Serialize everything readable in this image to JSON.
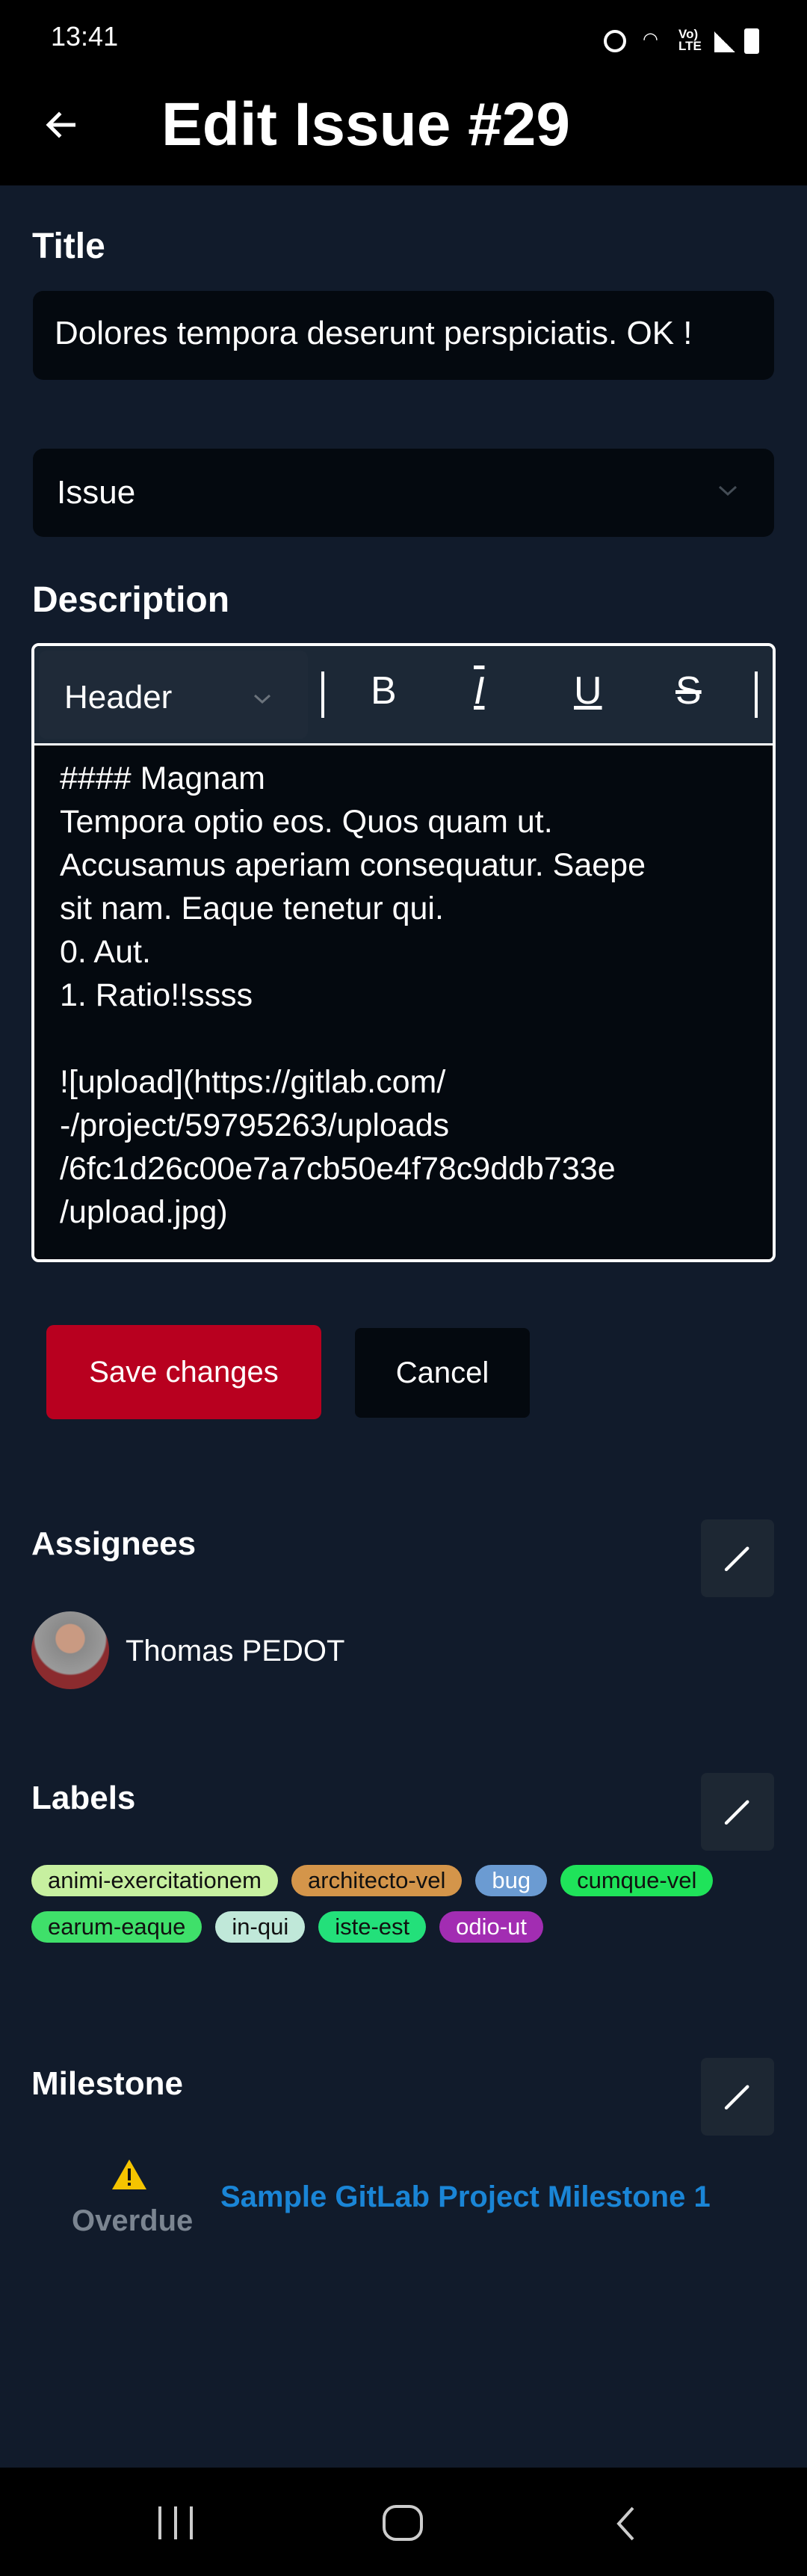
{
  "status_bar": {
    "time": "13:41"
  },
  "header": {
    "title": "Edit Issue #29"
  },
  "form": {
    "title_label": "Title",
    "title_value": "Dolores tempora deserunt perspiciatis. OK !",
    "type_value": "Issue",
    "description_label": "Description",
    "toolbar": {
      "header_select": "Header",
      "bold": "B",
      "italic": "I",
      "underline": "U",
      "strike": "S"
    },
    "description_lines": [
      "#### Magnam",
      "Tempora optio eos. Quos quam ut.",
      "Accusamus aperiam consequatur. Saepe",
      "sit nam. Eaque tenetur qui.",
      "0. Aut.",
      "1. Ratio!!ssss",
      "",
      "![upload](https://gitlab.com/",
      "-/project/59795263/uploads",
      "/6fc1d26c00e7a7cb50e4f78c9ddb733e",
      "/upload.jpg)"
    ],
    "save_label": "Save changes",
    "cancel_label": "Cancel"
  },
  "assignees": {
    "heading": "Assignees",
    "items": [
      {
        "name": "Thomas PEDOT"
      }
    ]
  },
  "labels": {
    "heading": "Labels",
    "items": [
      {
        "name": "animi-exercitationem",
        "color": "#c7f0a0",
        "text": "#111"
      },
      {
        "name": "architecto-vel",
        "color": "#d4954a",
        "text": "#111"
      },
      {
        "name": "bug",
        "color": "#6b9bd2",
        "text": "#fff"
      },
      {
        "name": "cumque-vel",
        "color": "#1fe35a",
        "text": "#111"
      },
      {
        "name": "earum-eaque",
        "color": "#3fe06a",
        "text": "#111"
      },
      {
        "name": "in-qui",
        "color": "#c0e8d9",
        "text": "#111"
      },
      {
        "name": "iste-est",
        "color": "#23e07a",
        "text": "#111"
      },
      {
        "name": "odio-ut",
        "color": "#a22db2",
        "text": "#fff"
      }
    ]
  },
  "milestone": {
    "heading": "Milestone",
    "status": "Overdue",
    "title": "Sample GitLab Project Milestone 1",
    "link_color": "#1a85d6"
  },
  "colors": {
    "background": "#111b2b",
    "save": "#b8001f",
    "warning": "#f5c400"
  }
}
